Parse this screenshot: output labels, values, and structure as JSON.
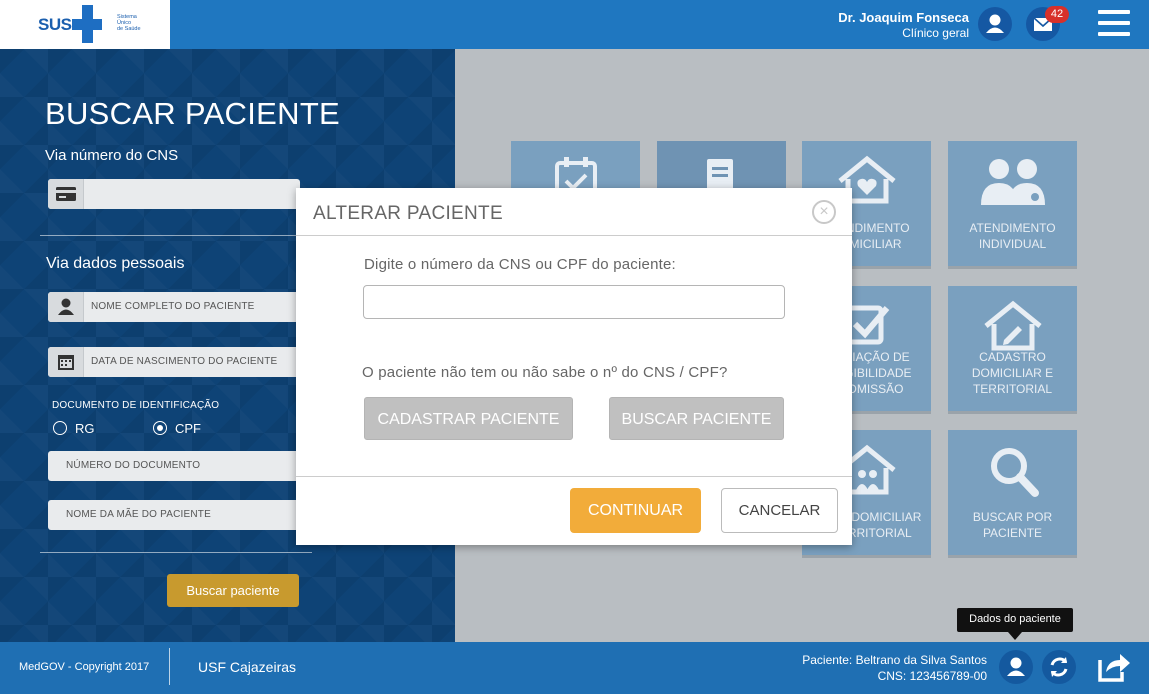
{
  "header": {
    "logo": {
      "brand": "SUS",
      "line1": "Sistema",
      "line2": "Único",
      "line3": "de Saúde"
    },
    "user_name": "Dr. Joaquim Fonseca",
    "user_role": "Clínico geral",
    "messages_count": "42"
  },
  "search_panel": {
    "title": "BUSCAR PACIENTE",
    "cns_section_label": "Via número do CNS",
    "personal_section_label": "Via dados pessoais",
    "full_name_placeholder": "NOME COMPLETO DO PACIENTE",
    "birth_date_placeholder": "DATA DE NASCIMENTO DO PACIENTE",
    "document_label": "DOCUMENTO DE IDENTIFICAÇÃO",
    "radio_rg": "RG",
    "radio_cpf": "CPF",
    "selected_document": "CPF",
    "document_number_placeholder": "NÚMERO DO DOCUMENTO",
    "mother_name_placeholder": "NOME DA MÃE DO PACIENTE",
    "search_button": "Buscar paciente"
  },
  "tiles": [
    {
      "line1": "",
      "line2": "",
      "icon": "calendar-icon"
    },
    {
      "line1": "",
      "line2": "",
      "icon": "document-icon"
    },
    {
      "line1": "ATENDIMENTO",
      "line2": "DOMICILIAR",
      "icon": "home-heart-icon"
    },
    {
      "line1": "ATENDIMENTO",
      "line2": "INDIVIDUAL",
      "icon": "doctor-patient-icon"
    },
    {
      "line1": "AVALIAÇÃO DE",
      "line2": "ELEGIBILIDADE",
      "line3": "E ADMISSÃO",
      "icon": "checkbox-icon"
    },
    {
      "line1": "CADASTRO",
      "line2": "DOMICILIAR E",
      "line3": "TERRITORIAL",
      "icon": "home-pencil-icon"
    },
    {
      "line1": "VISITA DOMICILIAR",
      "line2": "E TERRITORIAL",
      "icon": "home-family-icon"
    },
    {
      "line1": "BUSCAR POR",
      "line2": "PACIENTE",
      "icon": "magnifier-icon"
    }
  ],
  "modal": {
    "title": "ALTERAR PACIENTE",
    "prompt": "Digite o número da CNS ou CPF do paciente:",
    "input_value": "",
    "question": "O paciente não tem ou não sabe o nº do CNS / CPF?",
    "register_button": "CADASTRAR PACIENTE",
    "search_button": "BUSCAR PACIENTE",
    "continue_button": "CONTINUAR",
    "cancel_button": "CANCELAR"
  },
  "tooltip": "Dados do paciente",
  "footer": {
    "copyright": "MedGOV - Copyright 2017",
    "unit": "USF Cajazeiras",
    "patient_line": "Paciente: Beltrano da Silva Santos",
    "cns_line": "CNS: 123456789-00"
  },
  "colors": {
    "header_blue": "#1f77c0",
    "footer_blue": "#1f6fb3",
    "accent_orange": "#f2ac3a",
    "badge_red": "#d8302a"
  }
}
